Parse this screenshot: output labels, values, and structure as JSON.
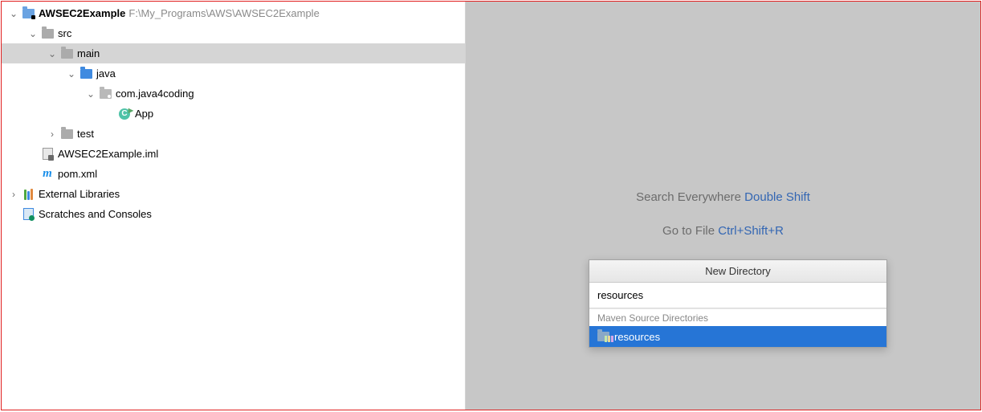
{
  "tree": {
    "project": {
      "name": "AWSEC2Example",
      "path": "F:\\My_Programs\\AWS\\AWSEC2Example"
    },
    "src": "src",
    "main": "main",
    "java": "java",
    "pkg": "com.java4coding",
    "app": "App",
    "test": "test",
    "iml": "AWSEC2Example.iml",
    "pom": "pom.xml",
    "ext": "External Libraries",
    "scr": "Scratches and Consoles",
    "classInitial": "C"
  },
  "mvn_glyph": "m",
  "hints": {
    "search_label": "Search Everywhere ",
    "search_key": "Double Shift",
    "goto_label": "Go to File ",
    "goto_key": "Ctrl+Shift+R"
  },
  "popup": {
    "title": "New Directory",
    "input_value": "resources",
    "section": "Maven Source Directories",
    "option": "resources"
  },
  "chev": {
    "down": "⌄",
    "right": "›"
  }
}
